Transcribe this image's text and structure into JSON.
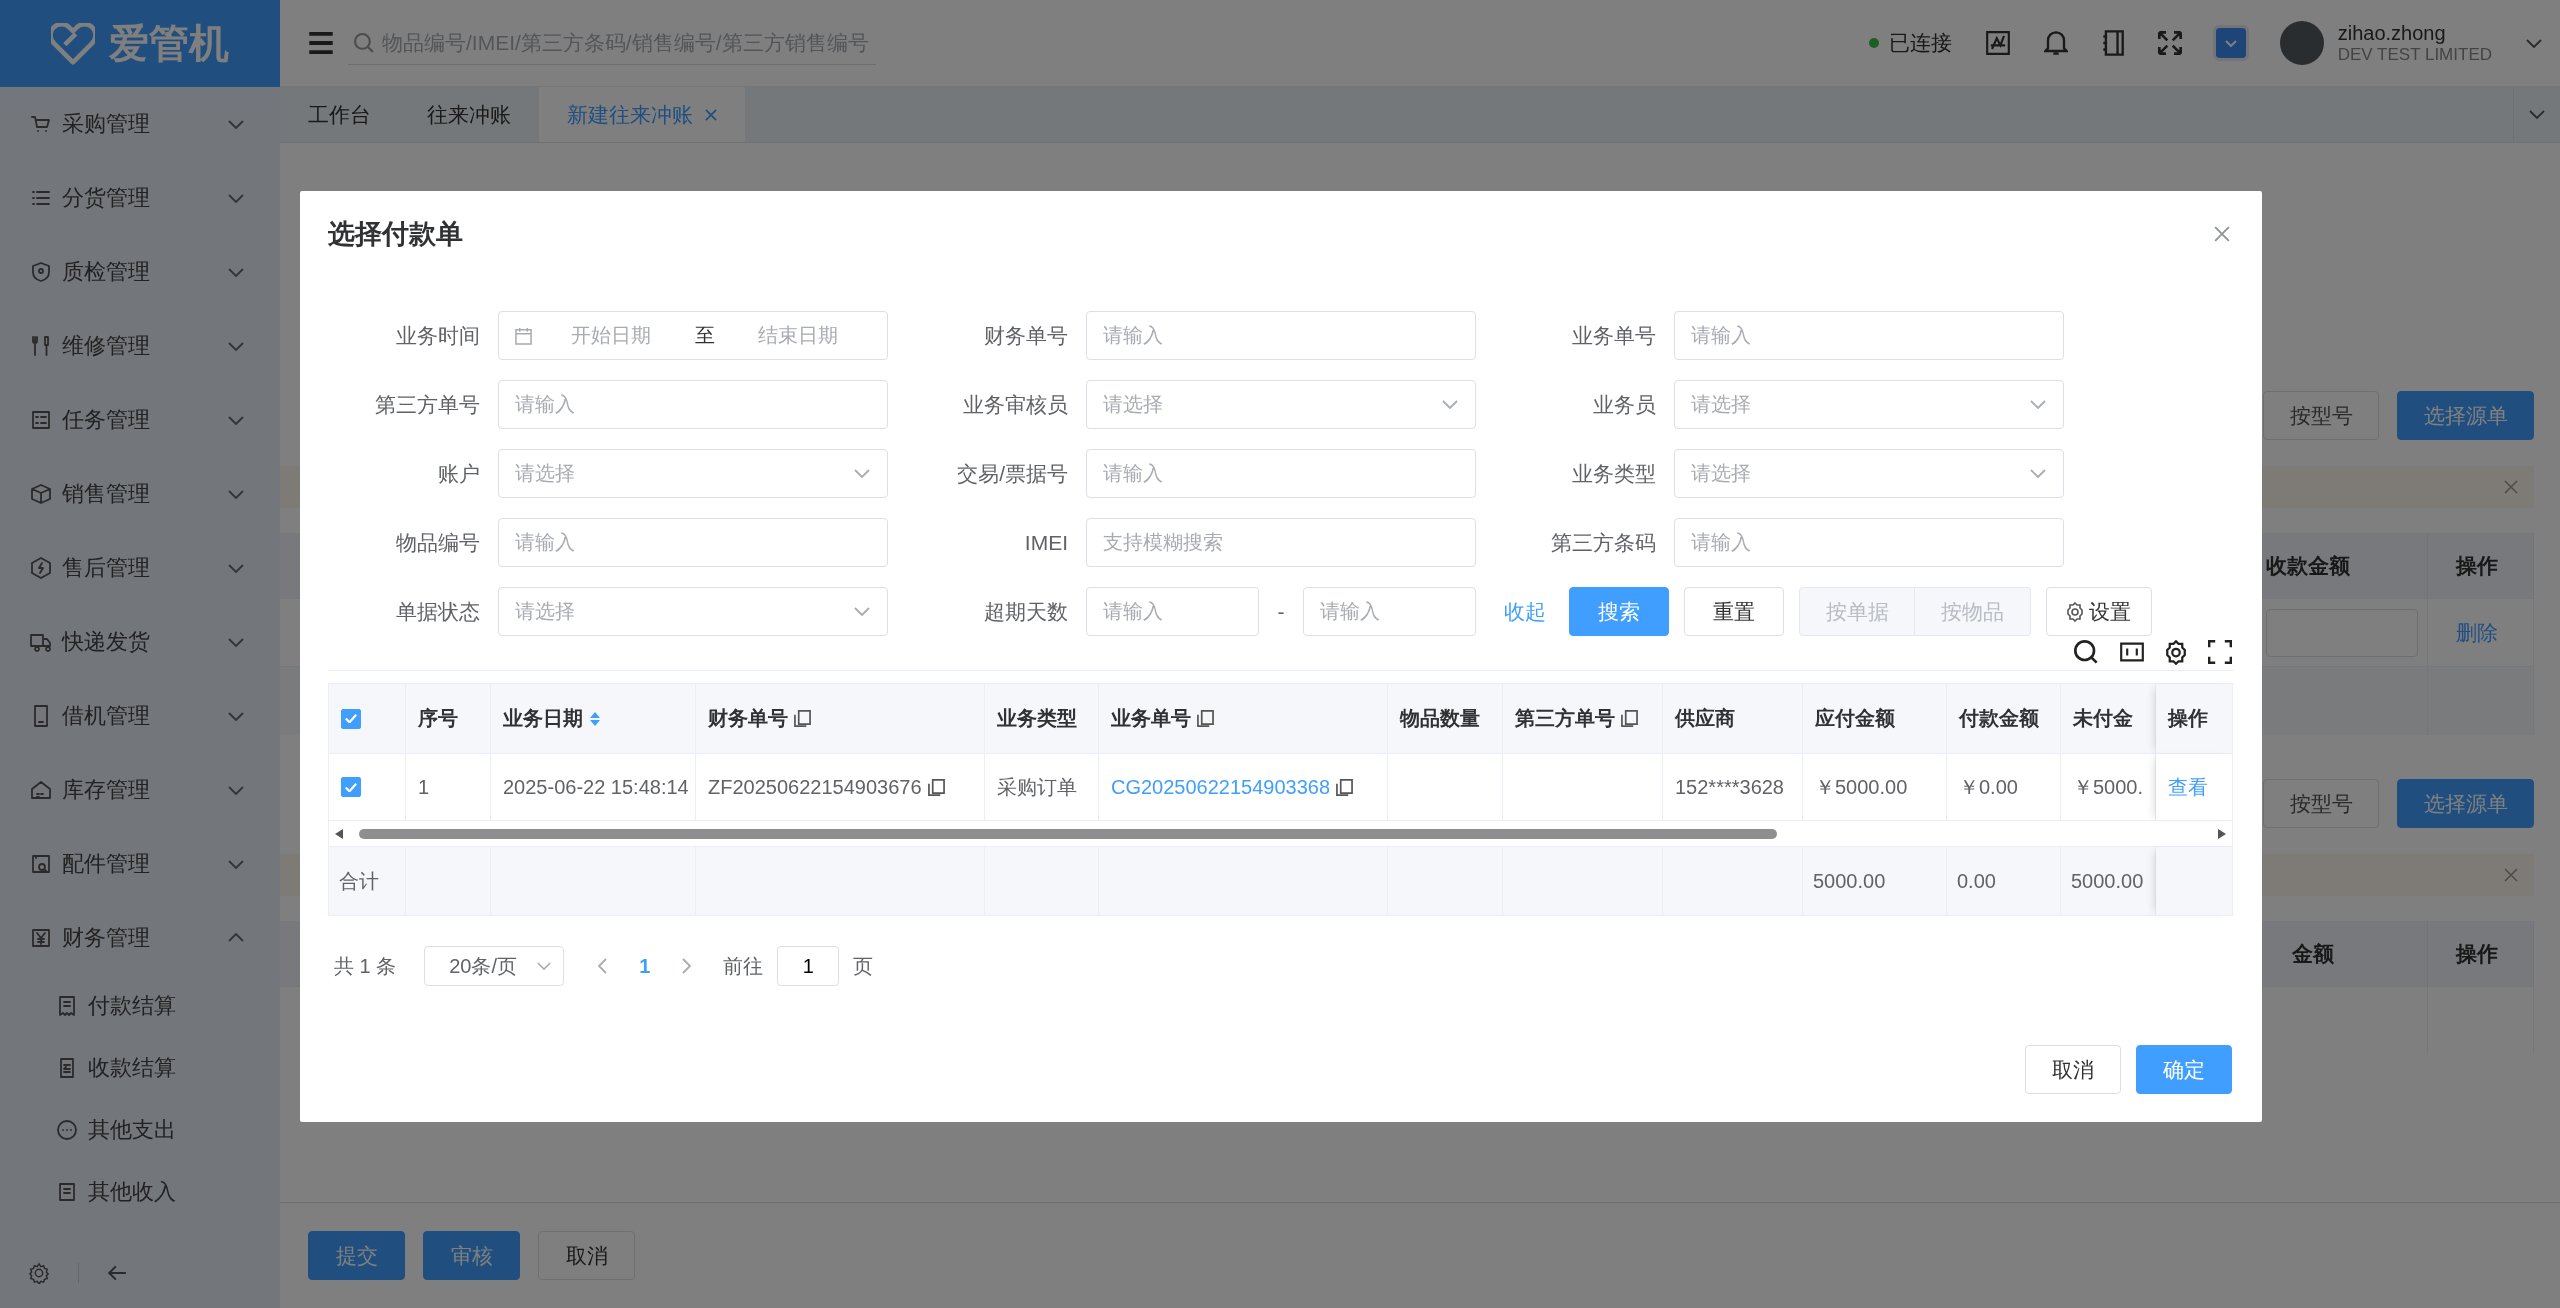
{
  "app": {
    "logo": "爱管机"
  },
  "header": {
    "search_placeholder": "物品编号/IMEI/第三方条码/销售编号/第三方销售编号",
    "connection": {
      "label": "已连接",
      "connected": true
    },
    "user": {
      "name": "zihao.zhong",
      "company": "DEV TEST LIMITED"
    }
  },
  "sidebar": {
    "items": [
      {
        "label": "采购管理",
        "expanded": false
      },
      {
        "label": "分货管理",
        "expanded": false
      },
      {
        "label": "质检管理",
        "expanded": false
      },
      {
        "label": "维修管理",
        "expanded": false
      },
      {
        "label": "任务管理",
        "expanded": false
      },
      {
        "label": "销售管理",
        "expanded": false
      },
      {
        "label": "售后管理",
        "expanded": false
      },
      {
        "label": "快递发货",
        "expanded": false
      },
      {
        "label": "借机管理",
        "expanded": false
      },
      {
        "label": "库存管理",
        "expanded": false
      },
      {
        "label": "配件管理",
        "expanded": false
      },
      {
        "label": "财务管理",
        "expanded": true,
        "children": [
          {
            "label": "付款结算"
          },
          {
            "label": "收款结算"
          },
          {
            "label": "其他支出"
          },
          {
            "label": "其他收入"
          }
        ]
      }
    ]
  },
  "tabs": [
    {
      "label": "工作台",
      "selected": false,
      "closable": false
    },
    {
      "label": "往来冲账",
      "selected": false,
      "closable": false
    },
    {
      "label": "新建往来冲账",
      "selected": true,
      "closable": true
    }
  ],
  "page": {
    "sections": [
      {
        "buttons": [
          "按型号",
          "选择源单"
        ],
        "columns": [
          "收款金额",
          "操作"
        ],
        "rows": [
          {
            "action": "删除"
          }
        ]
      },
      {
        "buttons": [
          "按型号",
          "选择源单"
        ],
        "columns": [
          "金额",
          "操作"
        ]
      }
    ],
    "actions": [
      {
        "label": "提交",
        "kind": "primary"
      },
      {
        "label": "审核",
        "kind": "primary"
      },
      {
        "label": "取消",
        "kind": "default"
      }
    ]
  },
  "dialog": {
    "title": "选择付款单",
    "filters": [
      {
        "label": "业务时间",
        "kind": "daterange",
        "start_placeholder": "开始日期",
        "separator": "至",
        "end_placeholder": "结束日期"
      },
      {
        "label": "财务单号",
        "kind": "input",
        "placeholder": "请输入"
      },
      {
        "label": "业务单号",
        "kind": "input",
        "placeholder": "请输入"
      },
      {
        "label": "第三方单号",
        "kind": "input",
        "placeholder": "请输入"
      },
      {
        "label": "业务审核员",
        "kind": "select",
        "placeholder": "请选择"
      },
      {
        "label": "业务员",
        "kind": "select",
        "placeholder": "请选择"
      },
      {
        "label": "账户",
        "kind": "select",
        "placeholder": "请选择"
      },
      {
        "label": "交易/票据号",
        "kind": "input",
        "placeholder": "请输入"
      },
      {
        "label": "业务类型",
        "kind": "select",
        "placeholder": "请选择"
      },
      {
        "label": "物品编号",
        "kind": "input",
        "placeholder": "请输入"
      },
      {
        "label": "IMEI",
        "kind": "input",
        "placeholder": "支持模糊搜索"
      },
      {
        "label": "第三方条码",
        "kind": "input",
        "placeholder": "请输入"
      },
      {
        "label": "单据状态",
        "kind": "select",
        "placeholder": "请选择"
      },
      {
        "label": "超期天数",
        "kind": "range",
        "start_placeholder": "请输入",
        "separator": "-",
        "end_placeholder": "请输入"
      }
    ],
    "collapse_link": "收起",
    "search_button": "搜索",
    "reset_button": "重置",
    "view_toggle": [
      {
        "label": "按单据",
        "disabled": true
      },
      {
        "label": "按物品",
        "disabled": true
      }
    ],
    "settings_button": "设置",
    "table": {
      "all_selected": true,
      "columns": [
        {
          "label": "序号"
        },
        {
          "label": "业务日期",
          "sortable": true
        },
        {
          "label": "财务单号",
          "copyable": true
        },
        {
          "label": "业务类型"
        },
        {
          "label": "业务单号",
          "copyable": true
        },
        {
          "label": "物品数量"
        },
        {
          "label": "第三方单号",
          "copyable": true
        },
        {
          "label": "供应商"
        },
        {
          "label": "应付金额"
        },
        {
          "label": "付款金额"
        },
        {
          "label": "未付金"
        },
        {
          "label": "操作"
        }
      ],
      "rows": [
        {
          "selected": true,
          "cells": [
            {
              "text": "1"
            },
            {
              "text": "2025-06-22 15:48:14"
            },
            {
              "text": "ZF20250622154903676",
              "copyable": true
            },
            {
              "text": "采购订单"
            },
            {
              "text": "CG20250622154903368",
              "copyable": true,
              "kind": "link"
            },
            null,
            null,
            {
              "text": "152****3628"
            },
            {
              "text": "￥5000.00"
            },
            {
              "text": "￥0.00"
            },
            {
              "text": "￥5000."
            },
            {
              "text": "查看",
              "kind": "link"
            }
          ]
        }
      ],
      "summary": {
        "label": "合计",
        "values": [
          "5000.00",
          "0.00",
          "5000.00"
        ]
      }
    },
    "pagination": {
      "total": "共 1 条",
      "page_size": "20条/页",
      "pages": [
        {
          "label": "1",
          "selected": true
        }
      ],
      "goto_label": "前往",
      "goto_value": "1",
      "goto_suffix": "页"
    },
    "footer": [
      {
        "label": "取消",
        "kind": "default"
      },
      {
        "label": "确定",
        "kind": "primary"
      }
    ]
  }
}
